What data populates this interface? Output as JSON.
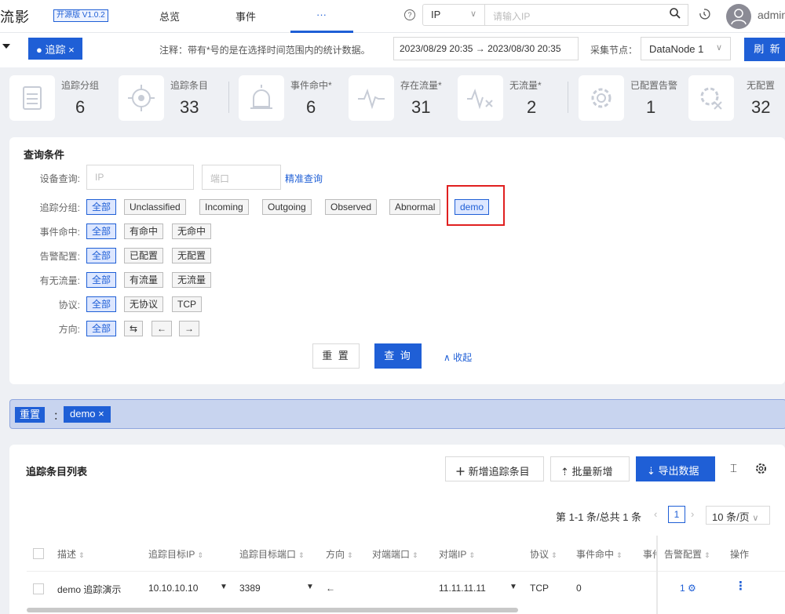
{
  "app": {
    "title": "流影",
    "version": "开源版 V1.0.2"
  },
  "nav": {
    "tabs": [
      "总览",
      "事件",
      "···"
    ],
    "user": "admin"
  },
  "search": {
    "type": "IP",
    "placeholder": "请输入IP"
  },
  "toolbar": {
    "tab": "追踪",
    "note": "注释：带有*号的是在选择时间范围内的统计数据。",
    "date_start": "2023/08/29 20:35",
    "date_end": "2023/08/30 20:35",
    "node_label": "采集节点：",
    "node": "DataNode 1",
    "refresh": "刷 新"
  },
  "stats": [
    {
      "label": "追踪分组",
      "value": "6",
      "icon": "layers-icon"
    },
    {
      "label": "追踪条目",
      "value": "33",
      "icon": "target-icon"
    },
    {
      "label": "事件命中*",
      "value": "6",
      "icon": "alarm-icon"
    },
    {
      "label": "存在流量*",
      "value": "31",
      "icon": "pulse-icon"
    },
    {
      "label": "无流量*",
      "value": "2",
      "icon": "no-pulse-icon"
    },
    {
      "label": "已配置告警",
      "value": "1",
      "icon": "gear-icon"
    },
    {
      "label": "无配置",
      "value": "32",
      "icon": "gear-x-icon"
    }
  ],
  "query": {
    "title": "查询条件",
    "device_label": "设备查询:",
    "ip_placeholder": "IP",
    "port_placeholder": "端口",
    "precise": "精准查询",
    "group_label": "追踪分组:",
    "groups": [
      "全部",
      "Unclassified",
      "Incoming",
      "Outgoing",
      "Observed",
      "Abnormal",
      "demo"
    ],
    "event_label": "事件命中:",
    "events": [
      "全部",
      "有命中",
      "无命中"
    ],
    "alert_label": "告警配置:",
    "alerts": [
      "全部",
      "已配置",
      "无配置"
    ],
    "flow_label": "有无流量:",
    "flows": [
      "全部",
      "有流量",
      "无流量"
    ],
    "proto_label": "协议:",
    "protos": [
      "全部",
      "无协议",
      "TCP"
    ],
    "dir_label": "方向:",
    "dirs": [
      "全部",
      "⇆",
      "←",
      "→"
    ],
    "reset": "重 置",
    "submit": "查 询",
    "collapse": "收起"
  },
  "filterbar": {
    "reset": "重置",
    "colon": "：",
    "tag": "demo ×"
  },
  "list": {
    "title": "追踪条目列表",
    "add": "新增追踪条目",
    "batch": "批量新增",
    "export": "导出数据",
    "pager_text": "第 1-1 条/总共 1 条",
    "page": "1",
    "page_size": "10 条/页",
    "columns": [
      "描述",
      "追踪目标IP",
      "追踪目标端口",
      "方向",
      "对端端口",
      "对端IP",
      "协议",
      "事件命中",
      "事件",
      "告警配置",
      "操作"
    ],
    "rows": [
      {
        "desc": "demo 追踪演示",
        "ip": "10.10.10.10",
        "port": "3389",
        "dir": "←",
        "peer_port": "",
        "peer_ip": "11.11.11.11",
        "proto": "TCP",
        "hits": "0",
        "alert": "1"
      }
    ]
  }
}
